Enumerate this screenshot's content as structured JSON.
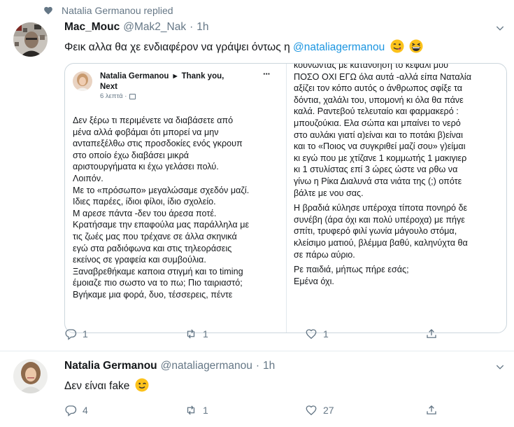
{
  "replied": {
    "text": "Natalia Germanou replied",
    "icon": "heart-icon"
  },
  "tweets": [
    {
      "author_name": "Mac_Mouc",
      "handle": "@Mak2_Nak",
      "dot": "·",
      "time": "1h",
      "text_before": "Φεικ αλλα θα χε ενδιαφέρον να γράψει όντως η",
      "mention": "@nataliagermanou",
      "emojis": [
        "face-savoring-emoji",
        "grinning-squinting-emoji"
      ],
      "actions": {
        "reply": "1",
        "retweet": "1",
        "like": "1"
      }
    },
    {
      "author_name": "Natalia Germanou",
      "handle": "@nataliagermanou",
      "dot": "·",
      "time": "1h",
      "text": "Δεν είναι fake",
      "emojis": [
        "winking-face-emoji"
      ],
      "actions": {
        "reply": "4",
        "retweet": "1",
        "like": "27"
      }
    }
  ],
  "embed": {
    "author": "Natalia Germanou",
    "arrow": "▸",
    "title_part1": "Thank you,",
    "title_part2": "Next",
    "time": "6 λεπτά ·",
    "more": "···",
    "left_lines": [
      "Δεν ξέρω τι περιμένετε να διαβάσετε από",
      "μένα αλλά φοβάμαι ότι μπορεί να μην",
      "ανταπεξέλθω στις προσδοκίες ενός γκρουπ",
      "στο οποίο έχω διαβάσει μικρά",
      "αριστουργήματα κι έχω γελάσει πολύ.",
      "Λοιπόν.",
      "Με το «πρόσωπο» μεγαλώσαμε σχεδόν μαζί.",
      "Ιδιες παρέες, ίδιοι φίλοι, ίδιο σχολείο.",
      "Μ αρεσε πάντα -δεν του άρεσα ποτέ.",
      "Κρατήσαμε την επαφούλα μας παράλληλα με",
      "τις ζωές μας που τρέχανε σε άλλα σκηνικά",
      "εγώ στα ραδιόφωνα και στις τηλεοράσεις",
      "εκείνος σε γραφεία και συμβούλια.",
      "Ξαναβρεθήκαμε καποια στιγμή και το timing",
      "έμοιαζε πιο σωστο να το πω; Πιο ταιριαστό;",
      "Βγήκαμε μια φορά, δυο, τέσσερεις, πέντε"
    ],
    "right_lines": [
      "κουνώντας με κατανόηση το κεφάλι μου",
      "ΠΟΣΟ ΟΧΙ ΕΓΩ όλα αυτά -αλλά είπα Ναταλία",
      "αξίζει τον κόπο αυτός ο άνθρωπος σφίξε τα",
      "δόντια, χαλάλι του, υπομονή κι όλα θα πάνε",
      "καλά. Ραντεβού τελευταίο και φαρμακερό :",
      "μπουζούκια. Ελα σώπα και μπαίνει το νερό",
      "στο αυλάκι γιατί α)είναι και το ποτάκι β)είναι",
      "και το «Ποιος να συγκριθεί μαζί σου» γ)είμαι",
      "κι εγώ που με χτίζανε 1 κομμωτής 1 μακιγιερ",
      "κι 1 στυλίστας επί 3 ώρες ώστε να ρθω να",
      "γίνω η Ρίκα Διαλυνά στα νιάτα της (;) οπότε",
      "βάλτε με νου σας.",
      "Η βραδιά κύλησε υπέροχα τίποτα πονηρό δε",
      "συνέβη (άρα όχι και πολύ υπέροχα) με πήγε",
      "σπίτι, τρυφερό φιλί γωνία μάγουλο στόμα,",
      "κλείσιμο ματιού, βλέμμα βαθύ, καληνύχτα θα",
      "σε πάρω αύριο.",
      "Ρε παιδιά, μήπως πήρε εσάς;",
      "Εμένα όχι."
    ]
  },
  "colors": {
    "text": "#14171a",
    "secondary": "#657786",
    "link": "#1b95e0",
    "border": "#e6ecf0"
  }
}
